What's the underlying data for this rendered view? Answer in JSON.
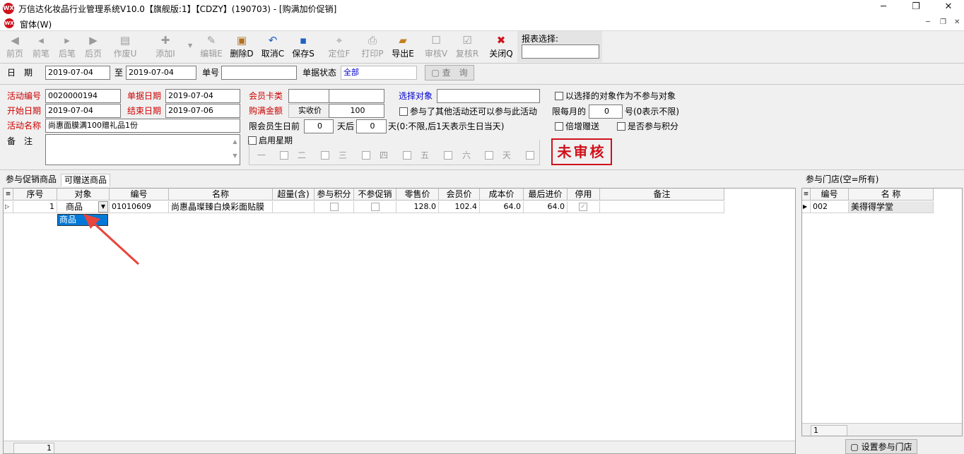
{
  "app": {
    "title": "万信达化妆品行业管理系统V10.0【旗舰版:1】【CDZY】(190703) - [购满加价促销]",
    "logo_text": "WX",
    "menu_item": "窗体(W)"
  },
  "toolbar": {
    "buttons": [
      {
        "label": "前页"
      },
      {
        "label": "前笔"
      },
      {
        "label": "后笔"
      },
      {
        "label": "后页"
      },
      {
        "label": "作废U"
      },
      {
        "label": "添加I"
      },
      {
        "label": "编辑E"
      },
      {
        "label": "删除D"
      },
      {
        "label": "取消C"
      },
      {
        "label": "保存S"
      },
      {
        "label": "定位F"
      },
      {
        "label": "打印P"
      },
      {
        "label": "导出E"
      },
      {
        "label": "审核V"
      },
      {
        "label": "复核R"
      },
      {
        "label": "关闭Q"
      }
    ],
    "report_label": "报表选择:",
    "report_value": ""
  },
  "filter": {
    "date_label": "日　期",
    "date_from": "2019-07-04",
    "to_label": "至",
    "date_to": "2019-07-04",
    "no_label": "单号",
    "no_value": "",
    "status_label": "单据状态",
    "status_value": "全部",
    "query_label": "查　询"
  },
  "form": {
    "activity_no_label": "活动编号",
    "activity_no": "0020000194",
    "doc_date_label": "单据日期",
    "doc_date": "2019-07-04",
    "card_type_label": "会员卡类",
    "card_type_a": "",
    "card_type_b": "",
    "select_target_label": "选择对象",
    "select_target": "",
    "exclude_label": "以选择的对象作为不参与对象",
    "start_date_label": "开始日期",
    "start_date": "2019-07-04",
    "end_date_label": "结束日期",
    "end_date": "2019-07-06",
    "full_amount_label": "购满金额",
    "price_type": "实收价",
    "full_amount": "100",
    "other_activity_label": "参与了其他活动还可以参与此活动",
    "monthly_label": "限每月的",
    "monthly_value": "0",
    "monthly_hint": "号(0表示不限)",
    "activity_name_label": "活动名称",
    "activity_name": "尚惠面膜满100赠礼品1份",
    "birthday_label": "限会员生日前",
    "birthday_before": "0",
    "after_label": "天后",
    "birthday_after": "0",
    "birthday_hint": "天(0:不限,后1天表示生日当天)",
    "double_gift_label": "倍增赠送",
    "points_label": "是否参与积分",
    "remark_label": "备　注",
    "remark": "",
    "weekday_label": "启用星期",
    "weekdays": [
      "一",
      "二",
      "三",
      "四",
      "五",
      "六",
      "天"
    ],
    "stamp": "未审核"
  },
  "tabs": {
    "left": [
      "参与促销商品",
      "可赠送商品"
    ],
    "right": "参与门店(空=所有)"
  },
  "grid": {
    "headers": [
      "序号",
      "对象",
      "编号",
      "名称",
      "超量(含)",
      "参与积分",
      "不参促销",
      "零售价",
      "会员价",
      "成本价",
      "最后进价",
      "停用",
      "备注"
    ],
    "row": {
      "seq": "1",
      "object": "商品",
      "code": "01010609",
      "name": "尚惠晶璨臻白焕彩面贴膜",
      "excess": "",
      "retail": "128.0",
      "member": "102.4",
      "cost": "64.0",
      "last": "64.0",
      "remark": ""
    },
    "dropdown_option": "商品",
    "footer_count": "1"
  },
  "store_grid": {
    "headers": [
      "编号",
      "名 称"
    ],
    "row": {
      "code": "002",
      "name": "美得得学堂"
    },
    "footer_count": "1",
    "set_button": "设置参与门店"
  },
  "colors": {
    "accent_red": "#cc0000",
    "label_blue": "#0000cc",
    "selection": "#0078d7"
  }
}
